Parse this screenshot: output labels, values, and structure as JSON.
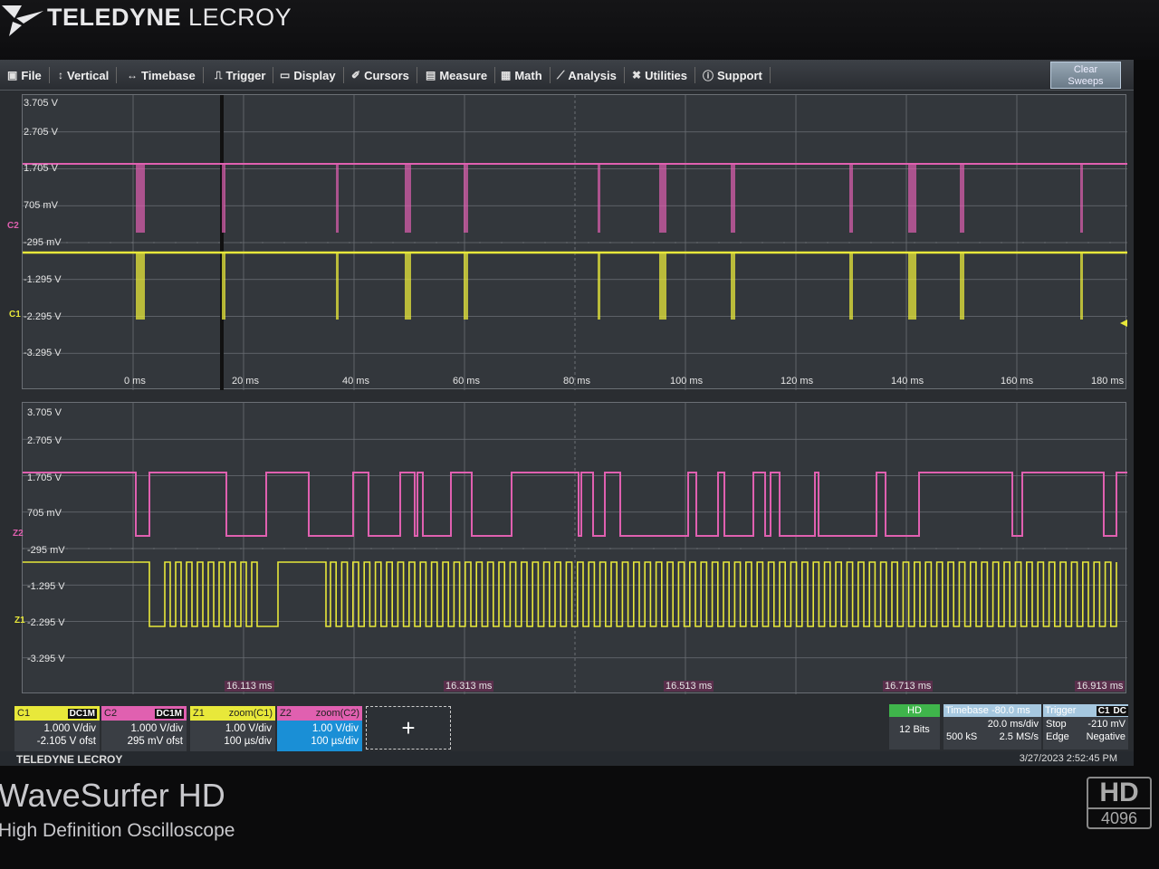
{
  "brand": {
    "name_bold": "TELEDYNE",
    "name_light": "LECROY"
  },
  "menu": [
    {
      "label": "File",
      "icon": "folder-icon",
      "glyph": "▣"
    },
    {
      "label": "Vertical",
      "icon": "vertical-icon",
      "glyph": "↕"
    },
    {
      "label": "Timebase",
      "icon": "timebase-icon",
      "glyph": "↔"
    },
    {
      "label": "Trigger",
      "icon": "trigger-icon",
      "glyph": "⎍"
    },
    {
      "label": "Display",
      "icon": "display-icon",
      "glyph": "▭"
    },
    {
      "label": "Cursors",
      "icon": "cursors-icon",
      "glyph": "✐"
    },
    {
      "label": "Measure",
      "icon": "measure-icon",
      "glyph": "▤"
    },
    {
      "label": "Math",
      "icon": "math-icon",
      "glyph": "▦"
    },
    {
      "label": "Analysis",
      "icon": "analysis-icon",
      "glyph": "⟋"
    },
    {
      "label": "Utilities",
      "icon": "tools-icon",
      "glyph": "✖"
    },
    {
      "label": "Support",
      "icon": "info-icon",
      "glyph": "ⓘ"
    }
  ],
  "clear_sweeps": {
    "line1": "Clear",
    "line2": "Sweeps"
  },
  "top_grid": {
    "volt_labels": [
      "3.705 V",
      "2.705 V",
      "1.705 V",
      "705 mV",
      "-295 mV",
      "-1.295 V",
      "-2.295 V",
      "-3.295 V"
    ],
    "time_labels": [
      "0 ms",
      "20 ms",
      "40 ms",
      "60 ms",
      "80 ms",
      "100 ms",
      "120 ms",
      "140 ms",
      "160 ms",
      "180 ms"
    ],
    "c2_marker": "C2",
    "c1_marker": "C1"
  },
  "bottom_grid": {
    "volt_labels": [
      "3.705 V",
      "2.705 V",
      "1.705 V",
      "705 mV",
      "-295 mV",
      "-1.295 V",
      "-2.295 V",
      "-3.295 V"
    ],
    "time_labels": [
      "16.113 ms",
      "16.313 ms",
      "16.513 ms",
      "16.713 ms",
      "16.913 ms"
    ],
    "z2_marker": "Z2",
    "z1_marker": "Z1"
  },
  "colors": {
    "c1": "#e8e83a",
    "c2": "#e060b0",
    "z1": "#e8e83a",
    "z2": "#e060b0",
    "grid": "#6b6f75"
  },
  "channels": [
    {
      "name": "C1",
      "coupling": "DC1M",
      "line1": "1.000 V/div",
      "line2": "-2.105 V ofst",
      "color": "#e8e83a"
    },
    {
      "name": "C2",
      "coupling": "DC1M",
      "line1": "1.000 V/div",
      "line2": "295 mV ofst",
      "color": "#e060b0"
    },
    {
      "name": "Z1",
      "coupling": "zoom(C1)",
      "line1": "1.00 V/div",
      "line2": "100 µs/div",
      "color": "#e8e83a"
    },
    {
      "name": "Z2",
      "coupling": "zoom(C2)",
      "line1": "1.00 V/div",
      "line2": "100 µs/div",
      "color": "#e060b0"
    }
  ],
  "add_channel": "+",
  "hd": {
    "label": "HD",
    "bits": "12 Bits"
  },
  "timebase": {
    "header": "Timebase -80.0 ms",
    "rate": "20.0 ms/div",
    "samples": "500 kS",
    "srate": "2.5 MS/s"
  },
  "trigger": {
    "header": "Trigger",
    "source": "C1",
    "coupling": "DC",
    "mode": "Stop",
    "level": "-210 mV",
    "type": "Edge",
    "slope": "Negative"
  },
  "status": {
    "brand": "TELEDYNE LECROY",
    "datetime": "3/27/2023 2:52:45 PM"
  },
  "model": {
    "name": "WaveSurfer HD",
    "subtitle": "High Definition Oscilloscope"
  },
  "emblem": {
    "big": "HD",
    "small": "4096"
  }
}
